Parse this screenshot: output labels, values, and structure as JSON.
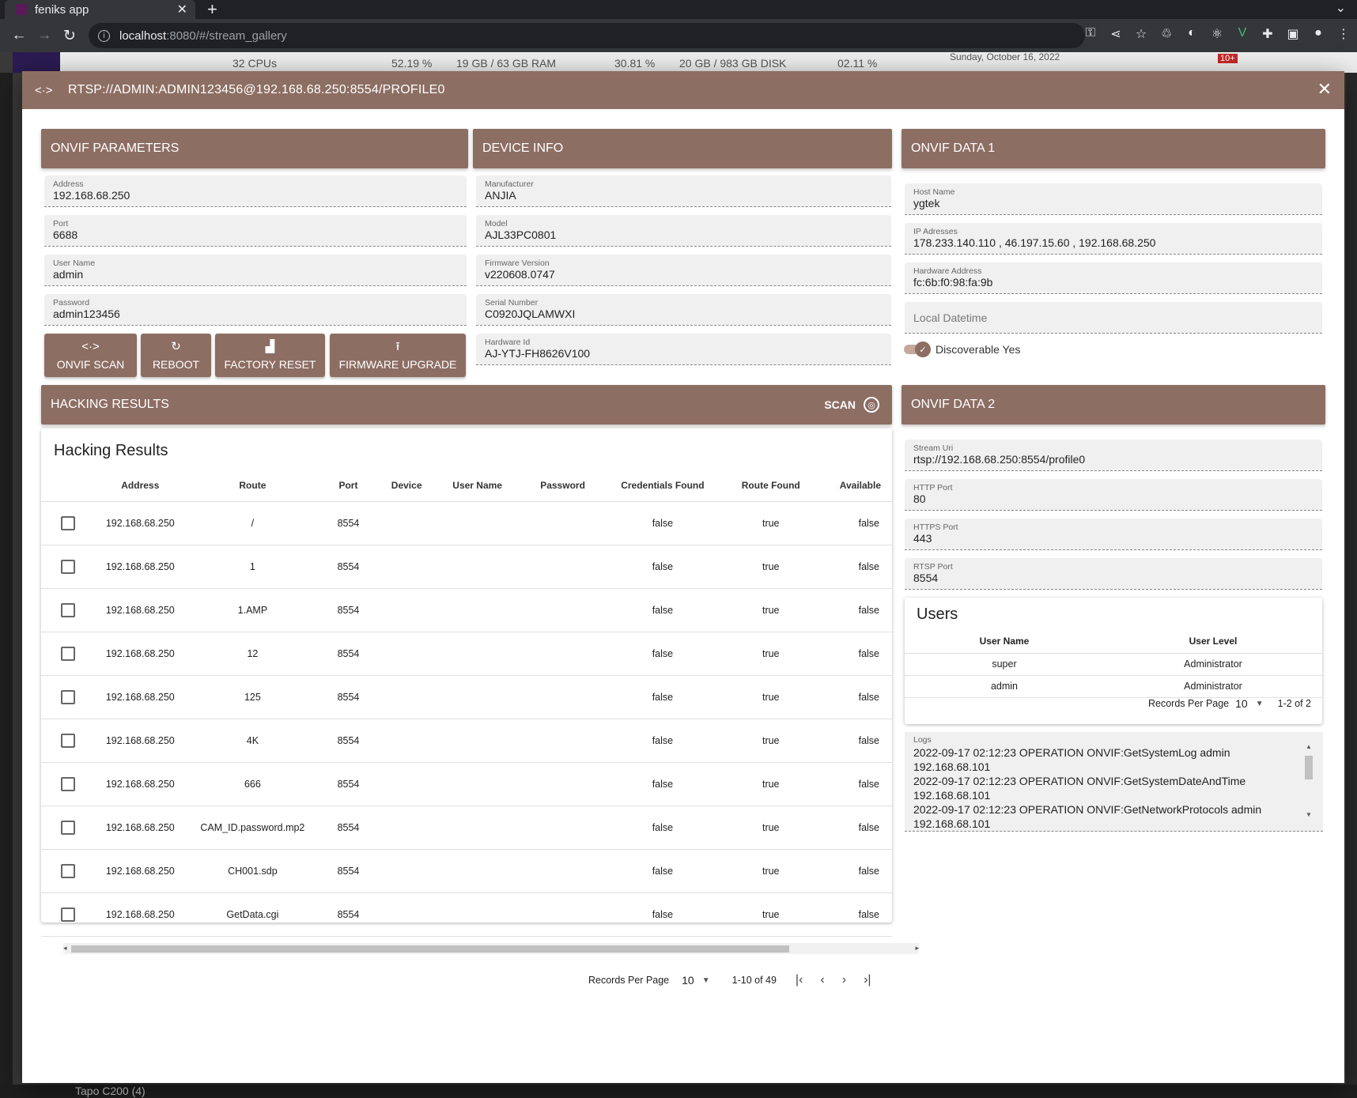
{
  "browser": {
    "tab_title": "feniks app",
    "url_host": "localhost",
    "url_path": ":8080/#/stream_gallery"
  },
  "background": {
    "cpus": "32 CPUs",
    "cpu_pct": "52.19 %",
    "ram": "19 GB / 63 GB RAM",
    "ram_pct": "30.81 %",
    "disk": "20 GB / 983 GB DISK",
    "disk_pct": "02.11 %",
    "date": "Sunday, October 16, 2022",
    "badge": "10+",
    "bottom_camera": "Tapo C200 (4)"
  },
  "dialog": {
    "title": "RTSP://ADMIN:ADMIN123456@192.168.68.250:8554/PROFILE0"
  },
  "onvif_params": {
    "header": "ONVIF PARAMETERS",
    "fields": [
      {
        "label": "Address",
        "value": "192.168.68.250"
      },
      {
        "label": "Port",
        "value": "6688"
      },
      {
        "label": "User Name",
        "value": "admin"
      },
      {
        "label": "Password",
        "value": "admin123456"
      }
    ],
    "buttons": {
      "scan": "ONVIF SCAN",
      "reboot": "REBOOT",
      "factory_reset": "FACTORY RESET",
      "firmware_upgrade": "FIRMWARE UPGRADE"
    }
  },
  "device_info": {
    "header": "DEVICE INFO",
    "fields": [
      {
        "label": "Manufacturer",
        "value": "ANJIA"
      },
      {
        "label": "Model",
        "value": "AJL33PC0801"
      },
      {
        "label": "Firmware Version",
        "value": "v220608.0747"
      },
      {
        "label": "Serial Number",
        "value": "C0920JQLAMWXI"
      },
      {
        "label": "Hardware Id",
        "value": "AJ-YTJ-FH8626V100"
      }
    ]
  },
  "onvif_data1": {
    "header": "ONVIF DATA 1",
    "fields": [
      {
        "label": "Host Name",
        "value": "ygtek"
      },
      {
        "label": "IP Adresses",
        "value": "178.233.140.110 , 46.197.15.60 , 192.168.68.250"
      },
      {
        "label": "Hardware Address",
        "value": "fc:6b:f0:98:fa:9b"
      }
    ],
    "local_datetime_placeholder": "Local Datetime",
    "discoverable_label": "Discoverable Yes"
  },
  "hacking": {
    "header": "HACKING RESULTS",
    "scan_label": "SCAN",
    "card_title": "Hacking Results",
    "columns": [
      "Address",
      "Route",
      "Port",
      "Device",
      "User Name",
      "Password",
      "Credentials Found",
      "Route Found",
      "Available"
    ],
    "rows": [
      {
        "address": "192.168.68.250",
        "route": "/",
        "port": "8554",
        "device": "",
        "user": "",
        "password": "",
        "cred": "false",
        "route_found": "true",
        "available": "false"
      },
      {
        "address": "192.168.68.250",
        "route": "1",
        "port": "8554",
        "device": "",
        "user": "",
        "password": "",
        "cred": "false",
        "route_found": "true",
        "available": "false"
      },
      {
        "address": "192.168.68.250",
        "route": "1.AMP",
        "port": "8554",
        "device": "",
        "user": "",
        "password": "",
        "cred": "false",
        "route_found": "true",
        "available": "false"
      },
      {
        "address": "192.168.68.250",
        "route": "12",
        "port": "8554",
        "device": "",
        "user": "",
        "password": "",
        "cred": "false",
        "route_found": "true",
        "available": "false"
      },
      {
        "address": "192.168.68.250",
        "route": "125",
        "port": "8554",
        "device": "",
        "user": "",
        "password": "",
        "cred": "false",
        "route_found": "true",
        "available": "false"
      },
      {
        "address": "192.168.68.250",
        "route": "4K",
        "port": "8554",
        "device": "",
        "user": "",
        "password": "",
        "cred": "false",
        "route_found": "true",
        "available": "false"
      },
      {
        "address": "192.168.68.250",
        "route": "666",
        "port": "8554",
        "device": "",
        "user": "",
        "password": "",
        "cred": "false",
        "route_found": "true",
        "available": "false"
      },
      {
        "address": "192.168.68.250",
        "route": "CAM_ID.password.mp2",
        "port": "8554",
        "device": "",
        "user": "",
        "password": "",
        "cred": "false",
        "route_found": "true",
        "available": "false"
      },
      {
        "address": "192.168.68.250",
        "route": "CH001.sdp",
        "port": "8554",
        "device": "",
        "user": "",
        "password": "",
        "cred": "false",
        "route_found": "true",
        "available": "false"
      },
      {
        "address": "192.168.68.250",
        "route": "GetData.cgi",
        "port": "8554",
        "device": "",
        "user": "",
        "password": "",
        "cred": "false",
        "route_found": "true",
        "available": "false"
      }
    ],
    "records_per_page_label": "Records Per Page",
    "records_per_page": "10",
    "range": "1-10 of 49"
  },
  "onvif_data2": {
    "header": "ONVIF DATA 2",
    "fields": [
      {
        "label": "Stream Uri",
        "value": "rtsp://192.168.68.250:8554/profile0"
      },
      {
        "label": "HTTP Port",
        "value": "80"
      },
      {
        "label": "HTTPS Port",
        "value": "443"
      },
      {
        "label": "RTSP Port",
        "value": "8554"
      }
    ],
    "users": {
      "title": "Users",
      "columns": [
        "User Name",
        "User Level"
      ],
      "rows": [
        {
          "name": "super",
          "level": "Administrator"
        },
        {
          "name": "admin",
          "level": "Administrator"
        }
      ],
      "records_per_page_label": "Records Per Page",
      "records_per_page": "10",
      "range": "1-2 of 2"
    },
    "logs_label": "Logs",
    "logs": [
      "2022-09-17 02:12:23 OPERATION ONVIF:GetSystemLog admin",
      "192.168.68.101",
      "2022-09-17 02:12:23 OPERATION ONVIF:GetSystemDateAndTime",
      "192.168.68.101",
      "2022-09-17 02:12:23 OPERATION ONVIF:GetNetworkProtocols admin",
      "192.168.68.101"
    ]
  },
  "colors": {
    "accent": "#8d6e63",
    "field_bg": "#f0f0f0"
  }
}
